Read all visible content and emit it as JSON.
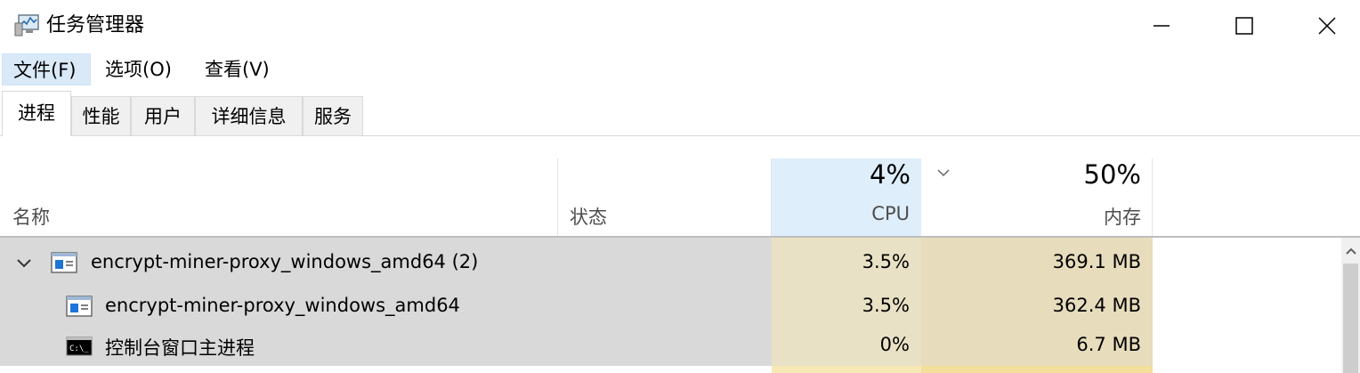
{
  "window": {
    "title": "任务管理器",
    "icon": "task-manager-icon",
    "controls": [
      "minimize-icon",
      "maximize-icon",
      "close-icon"
    ]
  },
  "menu": {
    "file": "文件(F)",
    "options": "选项(O)",
    "view": "查看(V)"
  },
  "tabs": [
    {
      "label": "进程",
      "active": true
    },
    {
      "label": "性能",
      "active": false
    },
    {
      "label": "用户",
      "active": false
    },
    {
      "label": "详细信息",
      "active": false
    },
    {
      "label": "服务",
      "active": false
    }
  ],
  "columns": {
    "name": "名称",
    "status": "状态",
    "cpu": {
      "label": "CPU",
      "total": "4%"
    },
    "memory": {
      "label": "内存",
      "total": "50%"
    }
  },
  "rows": [
    {
      "name": "encrypt-miner-proxy_windows_amd64 (2)",
      "cpu": "3.5%",
      "memory": "369.1 MB",
      "icon": "app-window-icon",
      "expanded": true
    },
    {
      "name": "encrypt-miner-proxy_windows_amd64",
      "cpu": "3.5%",
      "memory": "362.4 MB",
      "icon": "app-window-icon"
    },
    {
      "name": "控制台窗口主进程",
      "cpu": "0%",
      "memory": "6.7 MB",
      "icon": "console-icon"
    }
  ],
  "colors": {
    "selected_header": "#deeefb",
    "row_highlight": "#d9d9d9",
    "cpu_heat": "#e9e1c5",
    "memory_heat": "#e7dcbc"
  }
}
